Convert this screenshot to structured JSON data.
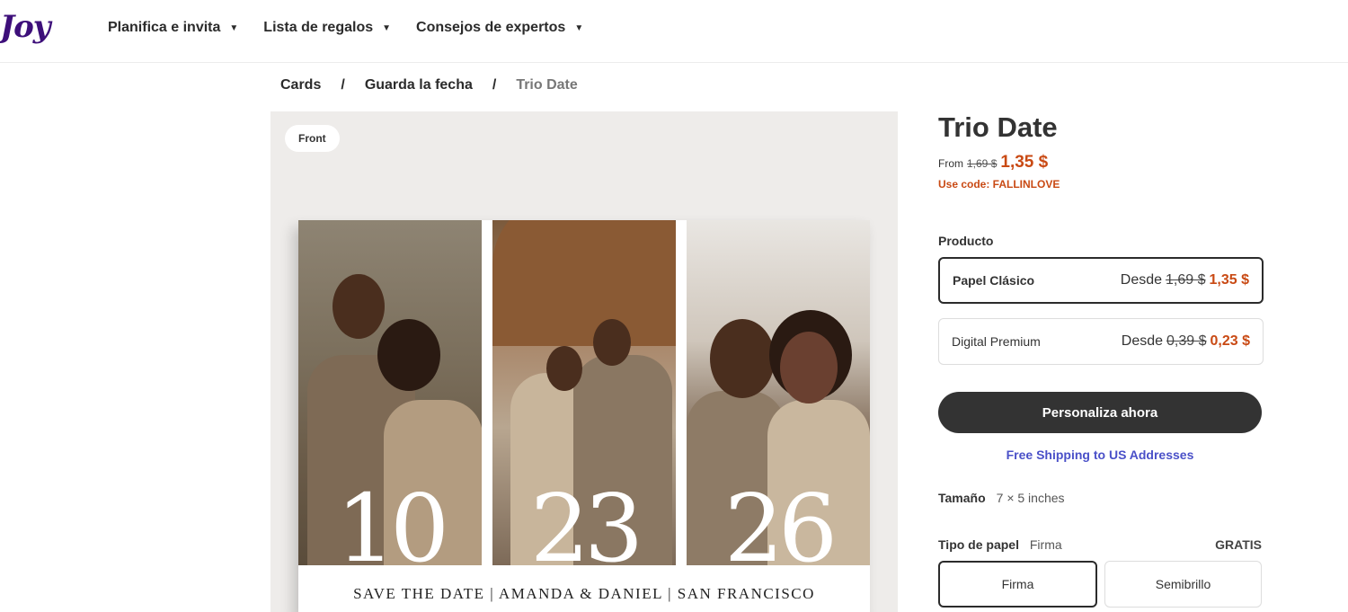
{
  "header": {
    "logo": "Joy",
    "nav": [
      {
        "label": "Planifica e invita"
      },
      {
        "label": "Lista de regalos"
      },
      {
        "label": "Consejos de expertos"
      }
    ]
  },
  "breadcrumb": {
    "items": [
      "Cards",
      "Guarda la fecha"
    ],
    "current": "Trio Date",
    "separator": "/"
  },
  "preview": {
    "side_label": "Front",
    "digits": [
      "10",
      "23",
      "26"
    ],
    "caption": "SAVE THE DATE  |  AMANDA & DANIEL  |  SAN FRANCISCO"
  },
  "product": {
    "title": "Trio Date",
    "from_label": "From",
    "old_price": "1,69 $",
    "price": "1,35 $",
    "promo": "Use code: FALLINLOVE",
    "section_label": "Producto",
    "options": [
      {
        "name": "Papel Clásico",
        "desde": "Desde",
        "old": "1,69 $",
        "now": "1,35 $",
        "selected": true
      },
      {
        "name": "Digital Premium",
        "desde": "Desde",
        "old": "0,39 $",
        "now": "0,23 $",
        "selected": false
      }
    ],
    "cta": "Personaliza ahora",
    "shipping": "Free Shipping to US Addresses",
    "size_label": "Tamaño",
    "size_value": "7 × 5 inches",
    "paper_label": "Tipo de papel",
    "paper_value": "Firma",
    "paper_price": "GRATIS",
    "paper_options": [
      "Firma",
      "Semibrillo"
    ]
  },
  "colors": {
    "brand": "#3d0f7a",
    "accent_price": "#c94a14",
    "link": "#4a50c8",
    "button": "#333333"
  }
}
